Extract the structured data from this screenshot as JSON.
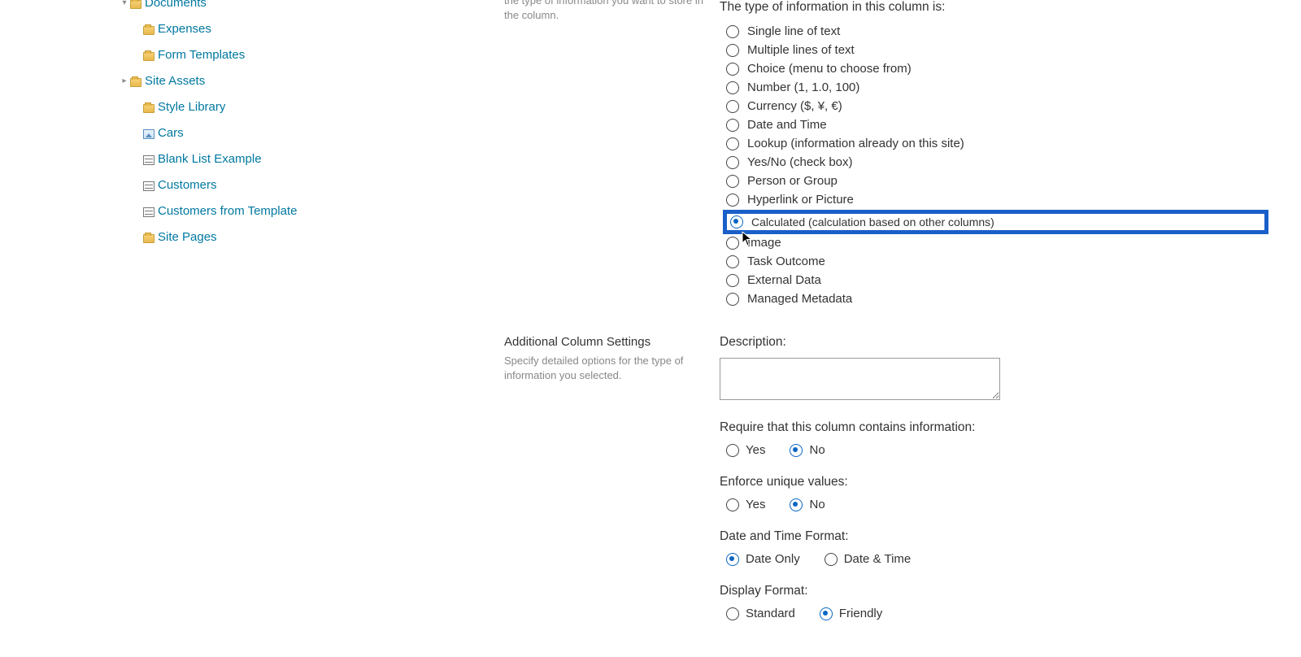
{
  "sidebar": {
    "items": [
      {
        "label": "Documents",
        "icon": "folder",
        "expandable": true,
        "partial": true
      },
      {
        "label": "Expenses",
        "icon": "folder",
        "indent": true
      },
      {
        "label": "Form Templates",
        "icon": "folder",
        "indent": true
      },
      {
        "label": "Site Assets",
        "icon": "folder",
        "expandable": true,
        "indent": true
      },
      {
        "label": "Style Library",
        "icon": "folder",
        "indent": true
      },
      {
        "label": "Cars",
        "icon": "image",
        "indent": true
      },
      {
        "label": "Blank List Example",
        "icon": "list",
        "indent": true
      },
      {
        "label": "Customers",
        "icon": "list",
        "indent": true
      },
      {
        "label": "Customers from Template",
        "icon": "list",
        "indent": true
      },
      {
        "label": "Site Pages",
        "icon": "folder",
        "indent": true
      }
    ]
  },
  "section1": {
    "desc": "the type of information you want to store in the column.",
    "heading": "The type of information in this column is:",
    "options": [
      {
        "label": "Single line of text"
      },
      {
        "label": "Multiple lines of text"
      },
      {
        "label": "Choice (menu to choose from)"
      },
      {
        "label": "Number (1, 1.0, 100)"
      },
      {
        "label": "Currency ($, ¥, €)"
      },
      {
        "label": "Date and Time"
      },
      {
        "label": "Lookup (information already on this site)"
      },
      {
        "label": "Yes/No (check box)"
      },
      {
        "label": "Person or Group"
      },
      {
        "label": "Hyperlink or Picture"
      },
      {
        "label": "Calculated (calculation based on other columns)",
        "checked": true,
        "highlighted": true
      },
      {
        "label": "Image"
      },
      {
        "label": "Task Outcome"
      },
      {
        "label": "External Data"
      },
      {
        "label": "Managed Metadata"
      }
    ]
  },
  "section2": {
    "title": "Additional Column Settings",
    "desc": "Specify detailed options for the type of information you selected.",
    "description_label": "Description:",
    "require_label": "Require that this column contains information:",
    "enforce_label": "Enforce unique values:",
    "datetime_label": "Date and Time Format:",
    "display_label": "Display Format:",
    "yes": "Yes",
    "no": "No",
    "date_only": "Date Only",
    "date_time": "Date & Time",
    "standard": "Standard",
    "friendly": "Friendly"
  }
}
